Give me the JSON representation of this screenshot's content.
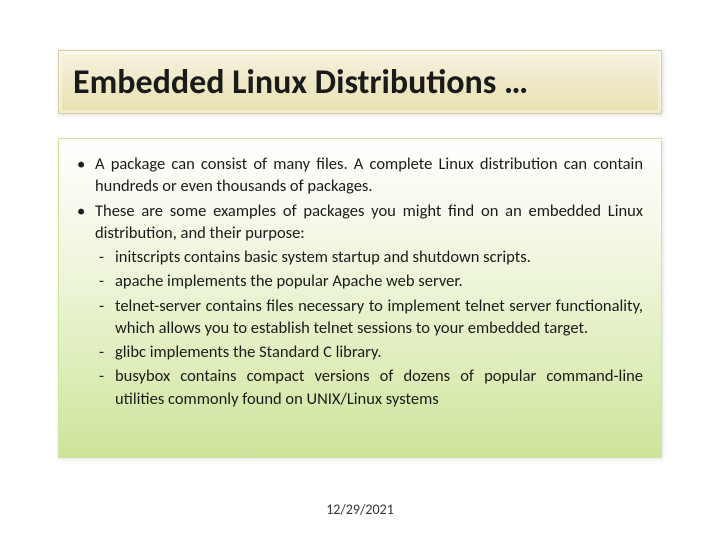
{
  "title": "Embedded Linux Distributions …",
  "bullets": [
    {
      "text": "A package can consist of many files. A complete Linux distribution can contain hundreds or even thousands of packages."
    },
    {
      "text": "These are some examples of packages you might find on an embedded Linux distribution, and their purpose:",
      "sub": [
        "initscripts contains basic system startup and shutdown scripts.",
        "apache implements the popular Apache web server.",
        "telnet-server contains files necessary to implement telnet server functionality, which allows you to establish telnet sessions to your embedded target.",
        "glibc implements the Standard C library.",
        "busybox contains compact versions of dozens of popular command-line utilities commonly found on UNIX/Linux systems"
      ]
    }
  ],
  "date": "12/29/2021",
  "marks": {
    "bullet": "•",
    "dash": "-"
  }
}
